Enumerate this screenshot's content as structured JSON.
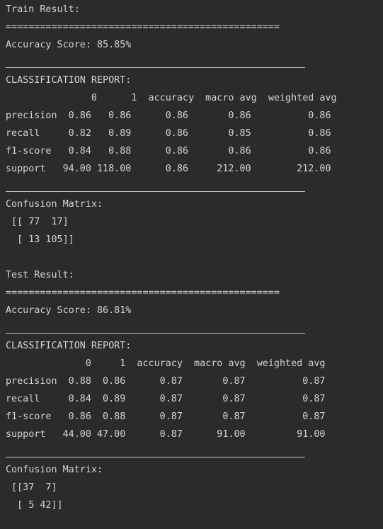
{
  "train": {
    "title": "Train Result:",
    "separator": "================================================",
    "accuracy_line": "Accuracy Score: 85.85%",
    "report_title": "CLASSIFICATION REPORT:",
    "report_lines": [
      "               0      1  accuracy  macro avg  weighted avg",
      "precision  0.86   0.86      0.86       0.86          0.86",
      "recall     0.82   0.89      0.86       0.85          0.86",
      "f1-score   0.84   0.88      0.86       0.86          0.86",
      "support   94.00 118.00      0.86     212.00        212.00"
    ],
    "matrix_title": "Confusion Matrix:",
    "matrix_lines": [
      " [[ 77  17]",
      "  [ 13 105]]"
    ]
  },
  "test": {
    "title": "Test Result:",
    "separator": "================================================",
    "accuracy_line": "Accuracy Score: 86.81%",
    "report_title": "CLASSIFICATION REPORT:",
    "report_lines": [
      "              0     1  accuracy  macro avg  weighted avg",
      "precision  0.88  0.86      0.87       0.87          0.87",
      "recall     0.84  0.89      0.87       0.87          0.87",
      "f1-score   0.86  0.88      0.87       0.87          0.87",
      "support   44.00 47.00      0.87      91.00         91.00"
    ],
    "matrix_title": "Confusion Matrix:",
    "matrix_lines": [
      " [[37  7]",
      "  [ 5 42]]"
    ]
  }
}
